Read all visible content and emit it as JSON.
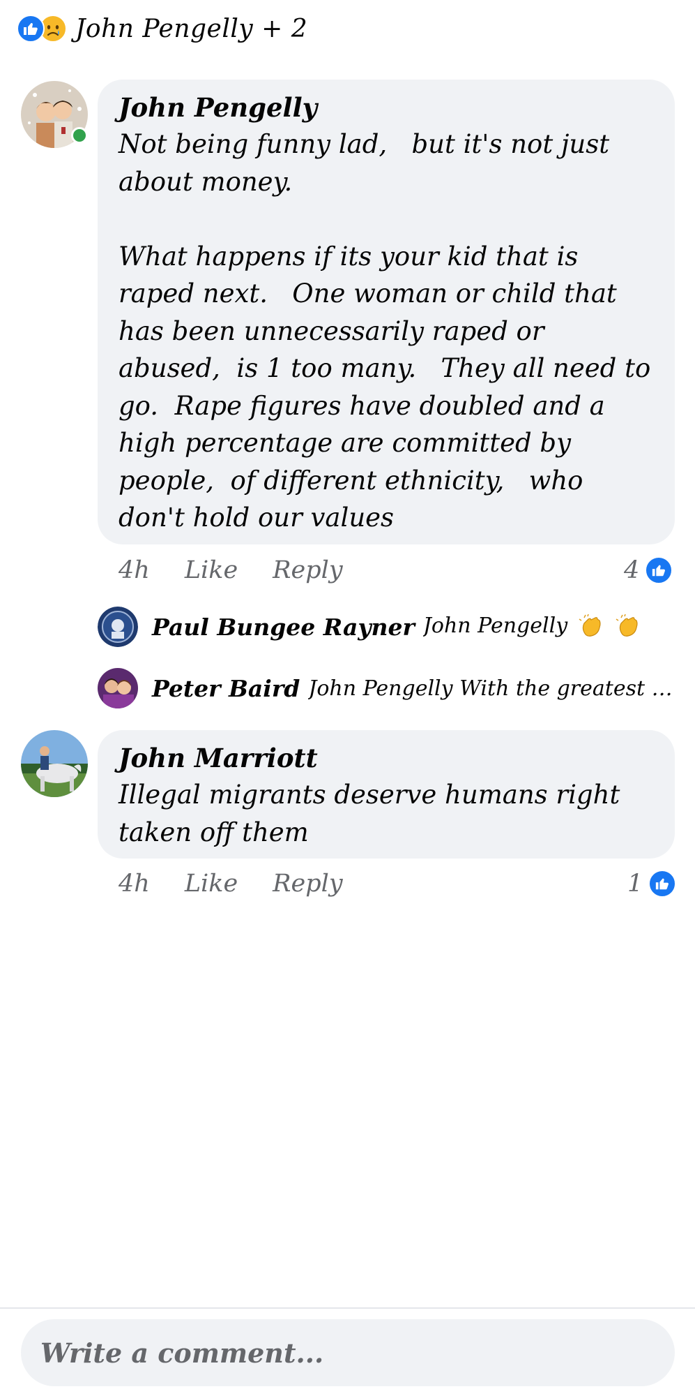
{
  "header": {
    "reaction_icons": [
      "like-icon",
      "sad-face-icon"
    ],
    "summary": "John Pengelly + 2"
  },
  "comments": [
    {
      "author": "John Pengelly",
      "online": true,
      "text": "Not being funny lad,   but it's not just about money.\n\nWhat happens if its your kid that is raped next.   One woman or child that has been unnecessarily raped or abused,  is 1 too many.   They all need to go.  Rape figures have doubled and a high percentage are committed by people,  of different ethnicity,   who don't hold our values",
      "time": "4h",
      "like_label": "Like",
      "reply_label": "Reply",
      "like_count": "4",
      "replies": [
        {
          "author": "Paul Bungee Rayner",
          "text": "John Pengelly",
          "emoji": [
            "clapping-hands-icon",
            "clapping-hands-icon"
          ]
        },
        {
          "author": "Peter Baird",
          "text": "John Pengelly With the greatest o..."
        }
      ]
    },
    {
      "author": "John Marriott",
      "online": false,
      "text": "Illegal migrants deserve humans right taken off them",
      "time": "4h",
      "like_label": "Like",
      "reply_label": "Reply",
      "like_count": "1"
    }
  ],
  "composer": {
    "placeholder": "Write a comment..."
  },
  "colors": {
    "like_blue": "#1877f2",
    "bubble_bg": "#f0f2f5",
    "meta_gray": "#65676b",
    "online_green": "#31a24c"
  }
}
